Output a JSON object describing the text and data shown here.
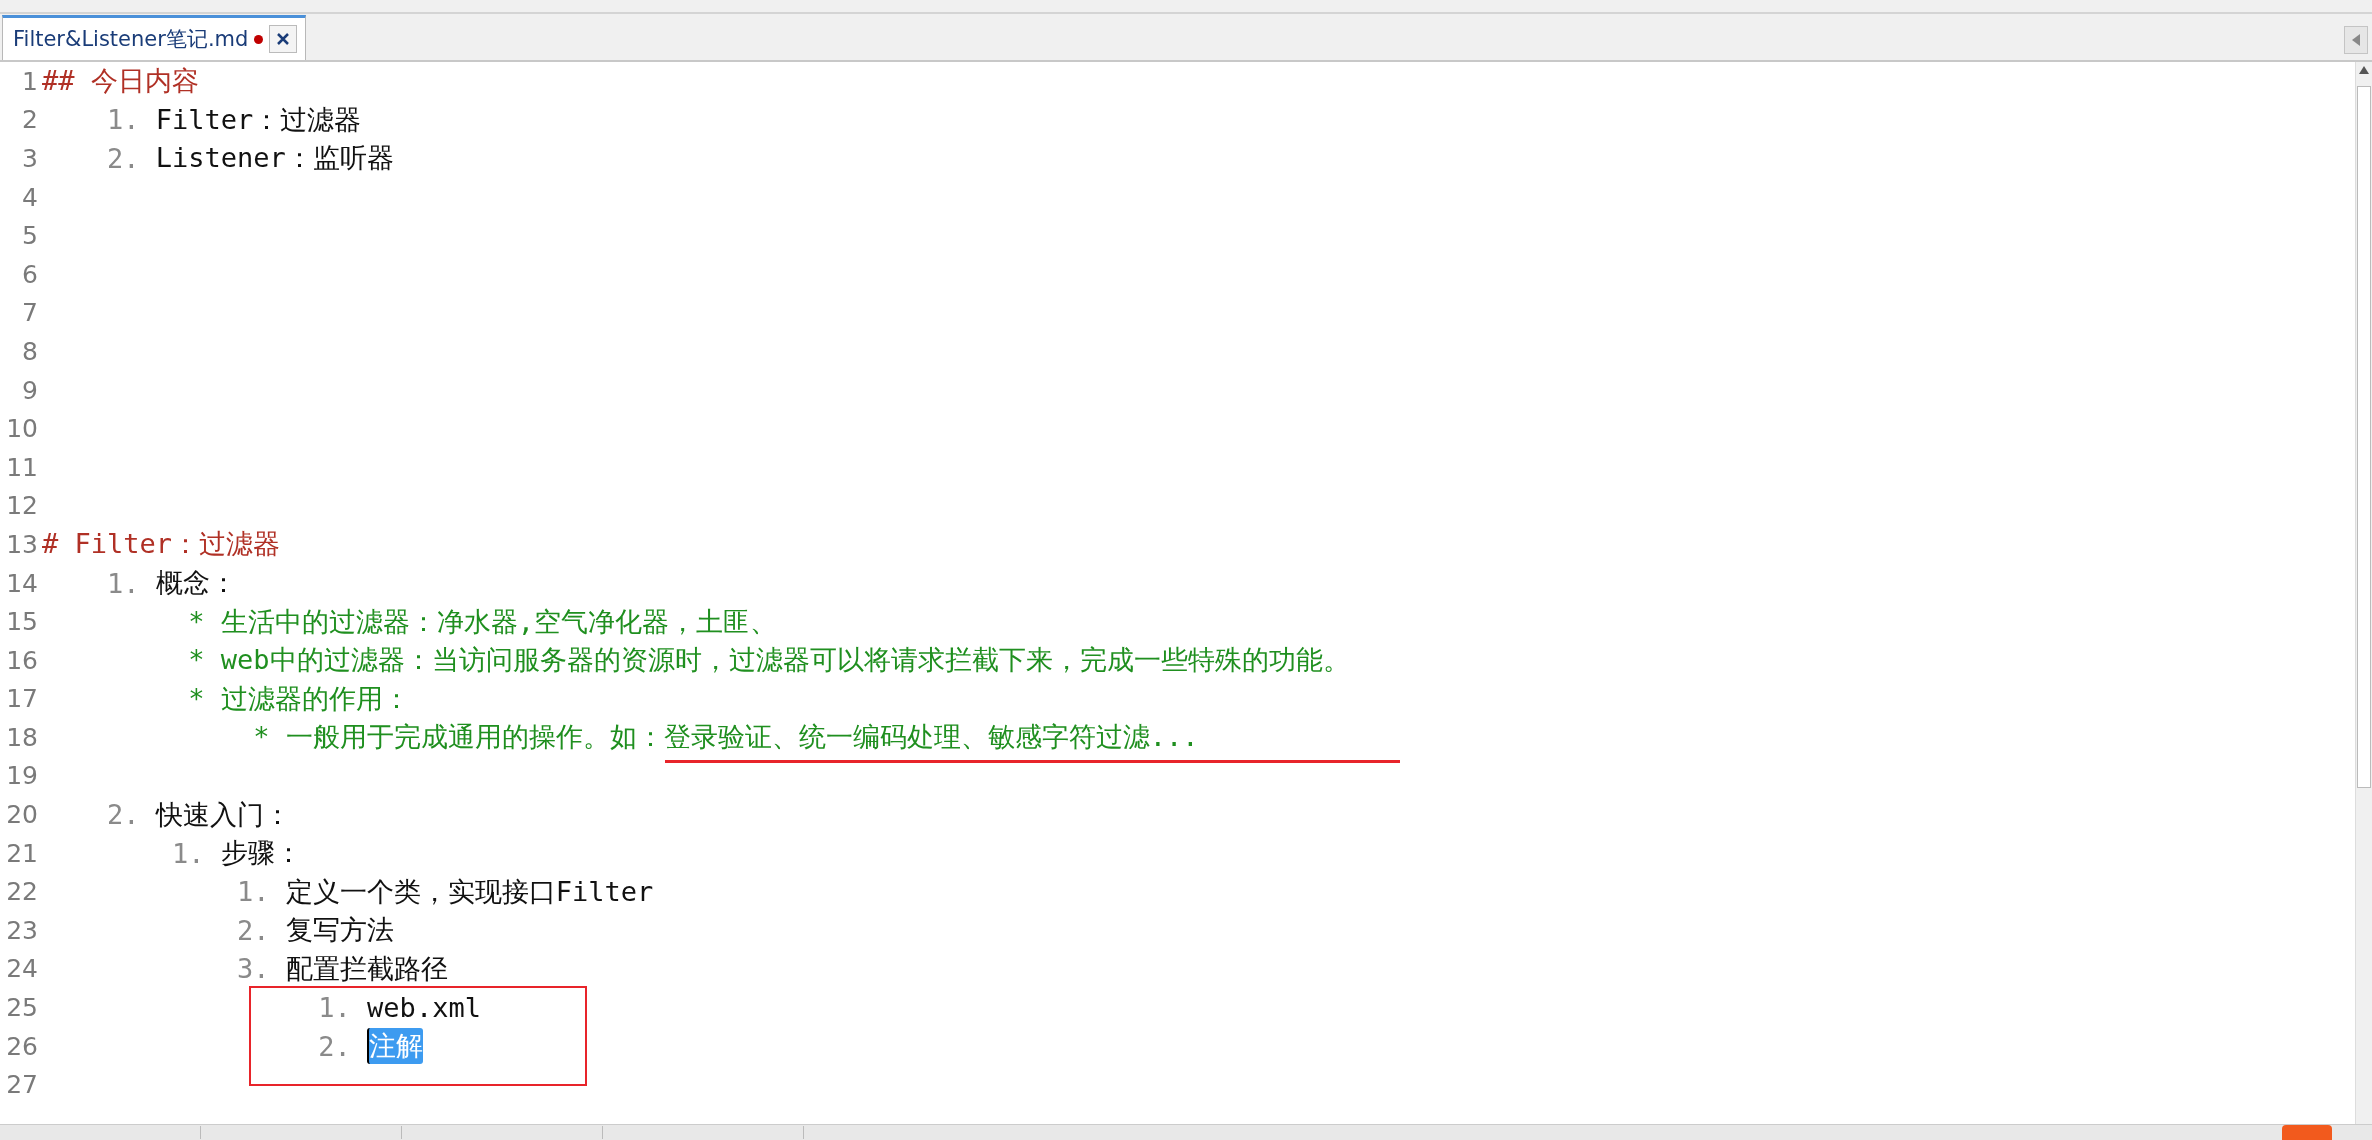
{
  "tab": {
    "title": "Filter&Listener笔记.md",
    "modified": true,
    "selected": true
  },
  "lines": [
    {
      "number": "1",
      "parts": [
        {
          "kind": "heading",
          "text": "## 今日内容"
        }
      ]
    },
    {
      "number": "2",
      "parts": [
        {
          "kind": "marker",
          "text": "    1. "
        },
        {
          "kind": "text",
          "text": "Filter：过滤器"
        }
      ]
    },
    {
      "number": "3",
      "parts": [
        {
          "kind": "marker",
          "text": "    2. "
        },
        {
          "kind": "text",
          "text": "Listener：监听器"
        }
      ]
    },
    {
      "number": "4"
    },
    {
      "number": "5"
    },
    {
      "number": "6"
    },
    {
      "number": "7"
    },
    {
      "number": "8"
    },
    {
      "number": "9"
    },
    {
      "number": "10"
    },
    {
      "number": "11"
    },
    {
      "number": "12"
    },
    {
      "number": "13",
      "parts": [
        {
          "kind": "heading",
          "text": "# Filter：过滤器"
        }
      ]
    },
    {
      "number": "14",
      "parts": [
        {
          "kind": "marker",
          "text": "    1. "
        },
        {
          "kind": "text",
          "text": "概念："
        }
      ]
    },
    {
      "number": "15",
      "parts": [
        {
          "kind": "bullet",
          "text": "         * 生活中的过滤器：净水器,空气净化器，土匪、"
        }
      ]
    },
    {
      "number": "16",
      "parts": [
        {
          "kind": "bullet",
          "text": "         * web中的过滤器：当访问服务器的资源时，过滤器可以将请求拦截下来，完成一些特殊的功能。"
        }
      ]
    },
    {
      "number": "17",
      "parts": [
        {
          "kind": "bullet",
          "text": "         * 过滤器的作用："
        }
      ]
    },
    {
      "number": "18",
      "parts": [
        {
          "kind": "bullet",
          "text": "             * 一般用于完成通用的操作。如：登录验证、统一编码处理、敏感字符过滤..."
        }
      ]
    },
    {
      "number": "19"
    },
    {
      "number": "20",
      "parts": [
        {
          "kind": "marker",
          "text": "    2. "
        },
        {
          "kind": "text",
          "text": "快速入门："
        }
      ]
    },
    {
      "number": "21",
      "parts": [
        {
          "kind": "marker",
          "text": "        1. "
        },
        {
          "kind": "text",
          "text": "步骤："
        }
      ]
    },
    {
      "number": "22",
      "parts": [
        {
          "kind": "marker",
          "text": "            1. "
        },
        {
          "kind": "text",
          "text": "定义一个类，实现接口Filter"
        }
      ]
    },
    {
      "number": "23",
      "parts": [
        {
          "kind": "marker",
          "text": "            2. "
        },
        {
          "kind": "text",
          "text": "复写方法"
        }
      ]
    },
    {
      "number": "24",
      "parts": [
        {
          "kind": "marker",
          "text": "            3. "
        },
        {
          "kind": "text",
          "text": "配置拦截路径"
        }
      ]
    },
    {
      "number": "25",
      "parts": [
        {
          "kind": "marker",
          "text": "                 1. "
        },
        {
          "kind": "text",
          "text": "web.xml"
        }
      ]
    },
    {
      "number": "26",
      "parts": [
        {
          "kind": "marker",
          "text": "                 2. "
        },
        {
          "kind": "selected",
          "text": "注解"
        }
      ]
    },
    {
      "number": "27"
    }
  ],
  "annotations": {
    "underline": true,
    "frame": true
  }
}
